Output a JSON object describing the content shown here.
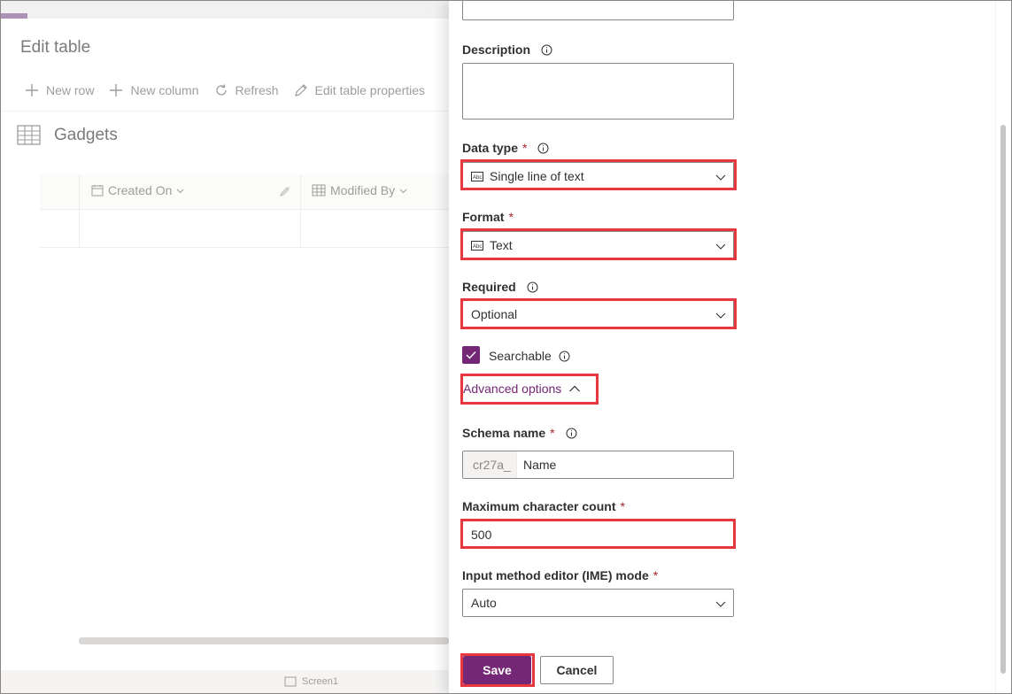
{
  "background": {
    "title": "Edit table",
    "toolbar": {
      "new_row": "New row",
      "new_column": "New column",
      "refresh": "Refresh",
      "edit_table_properties": "Edit table properties"
    },
    "table_name": "Gadgets",
    "columns": [
      "Created On",
      "Modified By"
    ],
    "bottom_tab": "Screen1"
  },
  "pane": {
    "description": {
      "label": "Description",
      "value": ""
    },
    "data_type": {
      "label": "Data type",
      "required_mark": "*",
      "value": "Single line of text",
      "icon": "abc-text-icon"
    },
    "format": {
      "label": "Format",
      "required_mark": "*",
      "value": "Text",
      "icon": "abc-text-icon"
    },
    "required": {
      "label": "Required",
      "value": "Optional"
    },
    "searchable": {
      "label": "Searchable",
      "checked": true
    },
    "advanced_options": {
      "label": "Advanced options",
      "expanded": true
    },
    "schema_name": {
      "label": "Schema name",
      "required_mark": "*",
      "prefix": "cr27a_",
      "value": "Name"
    },
    "max_char_count": {
      "label": "Maximum character count",
      "required_mark": "*",
      "value": "500"
    },
    "ime_mode": {
      "label": "Input method editor (IME) mode",
      "required_mark": "*",
      "value": "Auto"
    },
    "buttons": {
      "save": "Save",
      "cancel": "Cancel"
    }
  },
  "colors": {
    "accent": "#742774",
    "highlight": "#e8383f",
    "required": "#a4262c"
  }
}
